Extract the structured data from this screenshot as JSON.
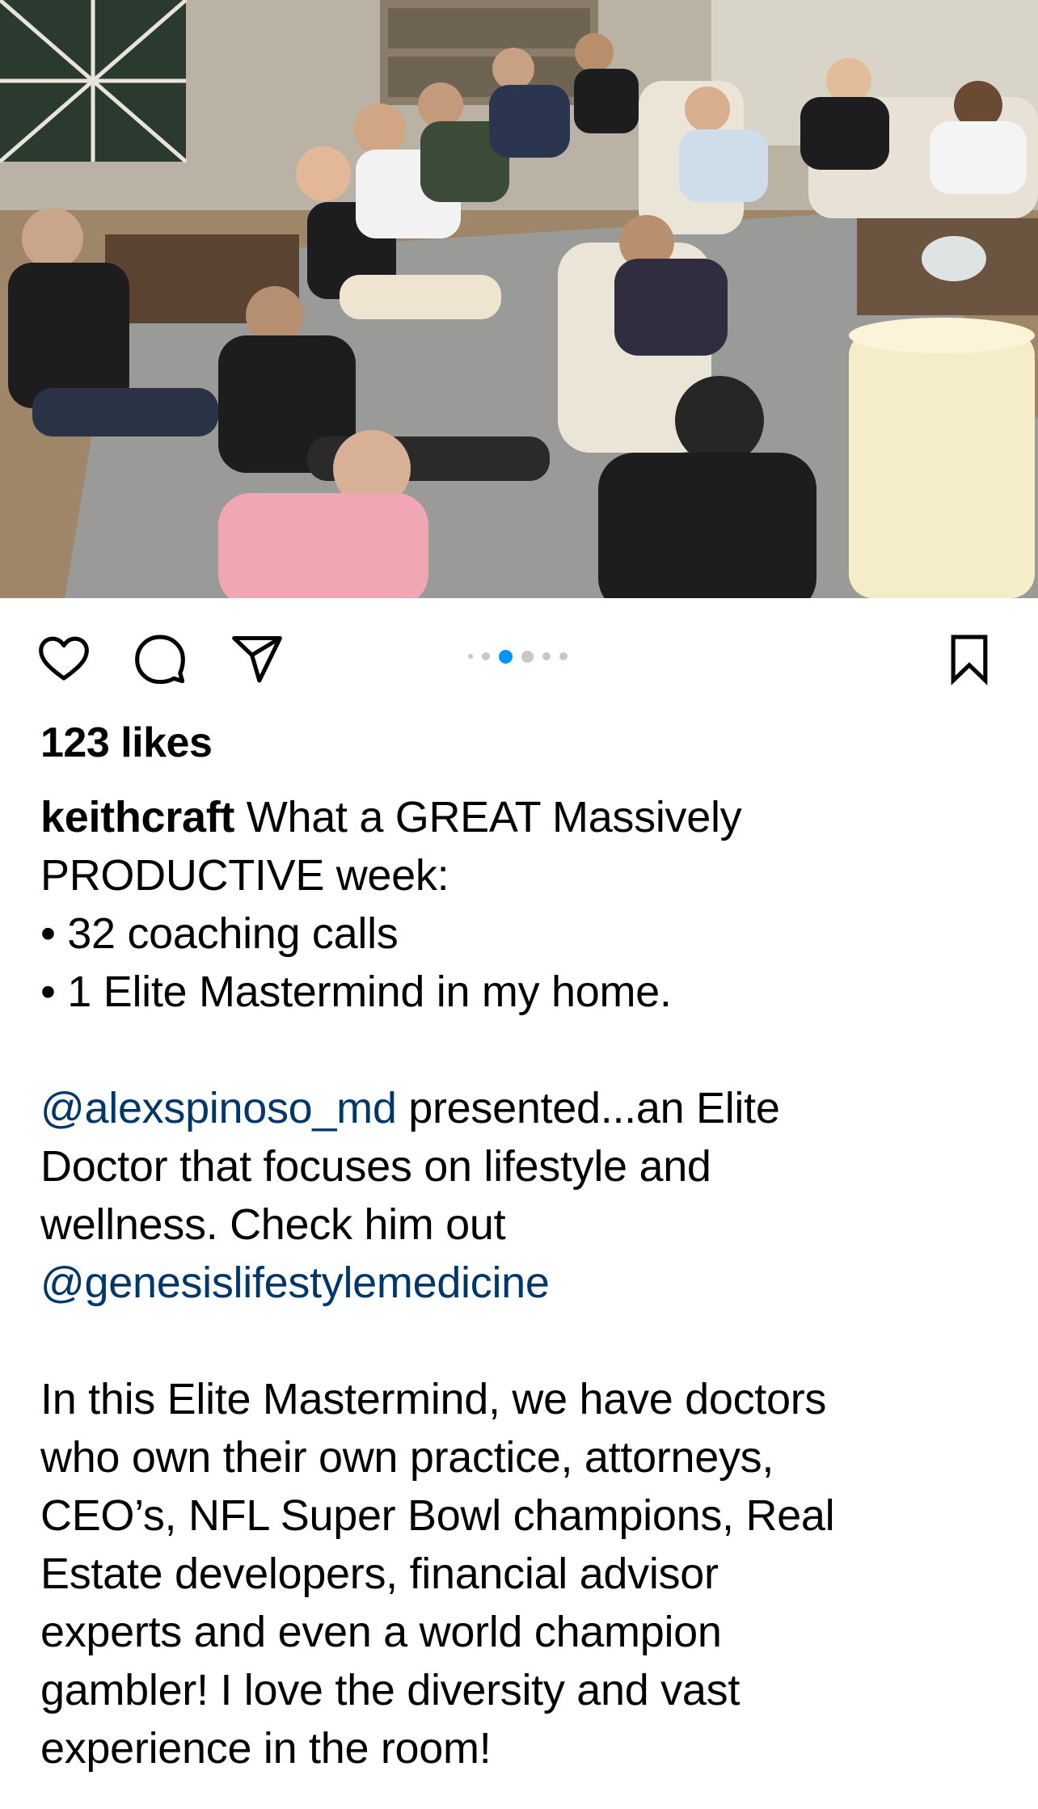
{
  "post": {
    "image": {
      "description_icon": "photo-mastermind-living-room"
    },
    "carousel": {
      "total": 6,
      "active_index": 2
    },
    "likes_text": "123 likes",
    "caption": {
      "username": "keithcraft",
      "line1_rest": " What a GREAT Massively",
      "line2": "PRODUCTIVE week:",
      "bullet1": "• 32 coaching calls",
      "bullet2": "• 1 Elite Mastermind in my home.",
      "mention1": "@alexspinoso_md",
      "line5_rest": " presented...an Elite",
      "line6": "Doctor that focuses on lifestyle and",
      "line7": "wellness. Check him out",
      "mention2": "@genesislifestylemedicine",
      "para3_lines": [
        "In this Elite Mastermind, we have doctors",
        "who own their own practice, attorneys,",
        "CEO’s, NFL Super Bowl champions, Real",
        "Estate developers, financial advisor",
        "experts and even a world champion",
        "gambler! I love the diversity and vast",
        "experience in the room!"
      ]
    }
  },
  "icons": {
    "like": "heart-outline-icon",
    "comment": "comment-bubble-icon",
    "share": "paper-plane-icon",
    "save": "bookmark-outline-icon"
  },
  "colors": {
    "link": "#00376b",
    "active_dot": "#0095f6",
    "inactive_dot": "#c7c7c7",
    "text": "#000000",
    "background": "#ffffff"
  }
}
